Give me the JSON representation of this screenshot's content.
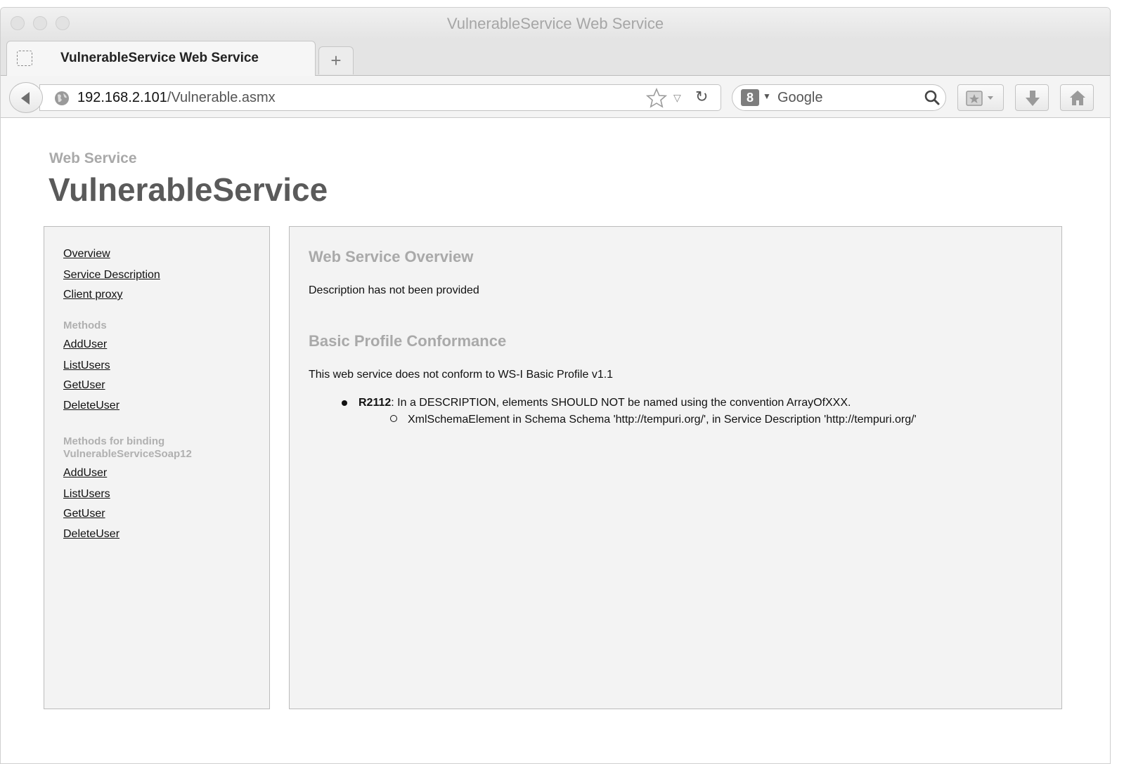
{
  "window": {
    "title": "VulnerableService Web Service"
  },
  "tab": {
    "title": "VulnerableService Web Service",
    "new_tab_label": "+"
  },
  "navbar": {
    "url_host": "192.168.2.101",
    "url_path": "/Vulnerable.asmx",
    "search_engine_glyph": "8",
    "search_placeholder": "Google"
  },
  "page": {
    "eyebrow": "Web Service",
    "service_name": "VulnerableService"
  },
  "sidebar": {
    "top_links": [
      "Overview",
      "Service Description",
      "Client proxy"
    ],
    "methods_heading": "Methods",
    "methods": [
      "AddUser",
      "ListUsers",
      "GetUser",
      "DeleteUser"
    ],
    "binding_heading_line1": "Methods for binding",
    "binding_heading_line2": "VulnerableServiceSoap12",
    "binding_methods": [
      "AddUser",
      "ListUsers",
      "GetUser",
      "DeleteUser"
    ]
  },
  "main": {
    "overview_heading": "Web Service Overview",
    "overview_text": "Description has not been provided",
    "conformance_heading": "Basic Profile Conformance",
    "conformance_text": "This web service does not conform to WS-I Basic Profile v1.1",
    "rule_id": "R2112",
    "rule_text": ": In a DESCRIPTION, elements SHOULD NOT be named using the convention ArrayOfXXX.",
    "rule_detail": "XmlSchemaElement in Schema Schema 'http://tempuri.org/', in Service Description 'http://tempuri.org/'"
  },
  "icons": {
    "back": "back-arrow-icon",
    "globe": "globe-icon",
    "bookmark": "star-icon",
    "reload": "reload-icon",
    "search": "magnifier-icon",
    "bookmarks_menu": "bookmarks-icon",
    "downloads": "download-icon",
    "home": "home-icon"
  }
}
